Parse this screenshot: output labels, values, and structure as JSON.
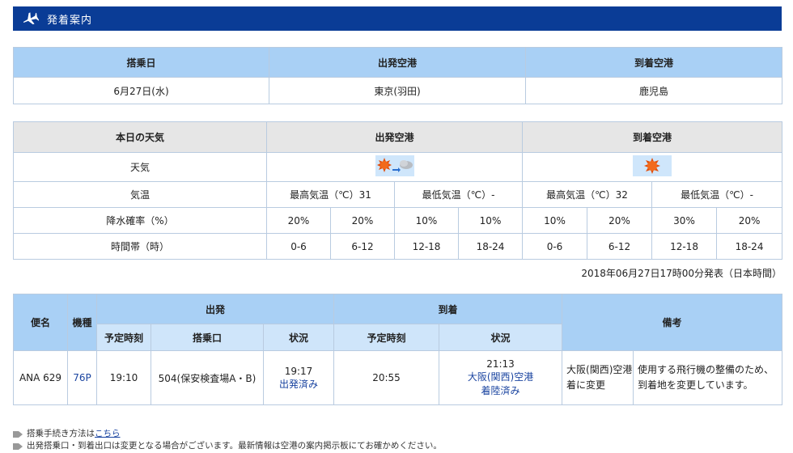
{
  "header": {
    "title": "発着案内",
    "icon": "airplane-icon"
  },
  "flight_summary": {
    "headers": [
      "搭乗日",
      "出発空港",
      "到着空港"
    ],
    "values": [
      "6月27日(水)",
      "東京(羽田)",
      "鹿児島"
    ]
  },
  "weather": {
    "label_today": "本日の天気",
    "dep_header": "出発空港",
    "arr_header": "到着空港",
    "row_weather": "天気",
    "row_temp": "気温",
    "row_precip": "降水確率（%）",
    "row_time": "時間帯（時）",
    "dep_icon": "sunny-then-cloudy-icon",
    "arr_icon": "sunny-icon",
    "dep_max": "最高気温（℃）31",
    "dep_min": "最低気温（℃）-",
    "arr_max": "最高気温（℃）32",
    "arr_min": "最低気温（℃）-",
    "dep_precip": [
      "20%",
      "20%",
      "10%",
      "10%"
    ],
    "arr_precip": [
      "10%",
      "20%",
      "30%",
      "20%"
    ],
    "time_slots": [
      "0-6",
      "6-12",
      "12-18",
      "18-24",
      "0-6",
      "6-12",
      "12-18",
      "18-24"
    ]
  },
  "issued": "2018年06月27日17時00分発表（日本時間）",
  "flight_table": {
    "col_flight": "便名",
    "col_aircraft": "機種",
    "col_departure": "出発",
    "col_arrival": "到着",
    "col_remarks": "備考",
    "sub_sched": "予定時刻",
    "sub_gate": "搭乗口",
    "sub_status": "状況",
    "sub_sched2": "予定時刻",
    "sub_status2": "状況",
    "row": {
      "flight": "ANA 629",
      "aircraft": "76P",
      "dep_time": "19:10",
      "gate": "504(保安検査場A・B)",
      "dep_actual": "19:17",
      "dep_status": "出発済み",
      "arr_time": "20:55",
      "arr_actual": "21:13",
      "arr_airport": "大阪(関西)空港",
      "arr_status": "着陸済み",
      "remark_short": "大阪(関西)空港着に変更",
      "remark_long": "使用する飛行機の整備のため、到着地を変更しています。"
    }
  },
  "notes": {
    "note1_text": "搭乗手続き方法は",
    "note1_link": "こちら",
    "note2_text": "出発搭乗口・到着出口は変更となる場合がございます。最新情報は空港の案内掲示板にてお確かめください。"
  }
}
